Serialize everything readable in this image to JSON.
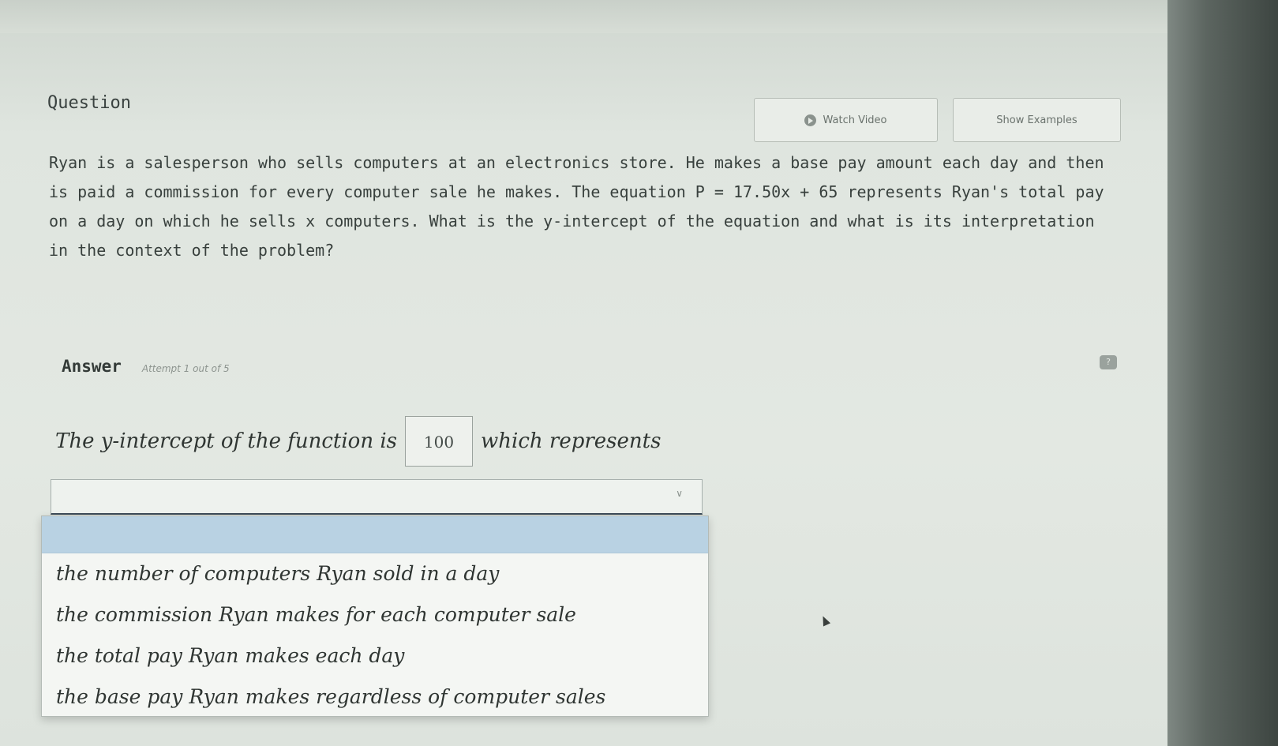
{
  "header": {
    "question_label": "Question",
    "video_button_label": "Watch Video",
    "example_button_label": "Show Examples"
  },
  "question": {
    "text": "Ryan is a salesperson who sells computers at an electronics store. He makes a base pay amount each day and then is paid a commission for every computer sale he makes. The equation P = 17.50x + 65 represents Ryan's total pay on a day on which he sells x computers. What is the y-intercept of the equation and what is its interpretation in the context of the problem?"
  },
  "answer": {
    "label": "Answer",
    "attempt_text": "Attempt 1 out of 5",
    "sentence_intro": "The y-intercept of the function is",
    "intercept_value": "100",
    "sentence_tail": "which represents",
    "dropdown_selected": "",
    "options": [
      "the number of computers Ryan sold in a day",
      "the commission Ryan makes for each computer sale",
      "the total pay Ryan makes each day",
      "the base pay Ryan makes regardless of computer sales"
    ]
  },
  "icons": {
    "play": "play-circle-icon",
    "help": "help-icon",
    "chevron": "chevron-down-icon",
    "cursor": "mouse-cursor-icon"
  },
  "colors": {
    "background": "#e3e8e2",
    "menu_highlight": "#b9d2e3",
    "dropdown_border": "#3b4a57"
  }
}
